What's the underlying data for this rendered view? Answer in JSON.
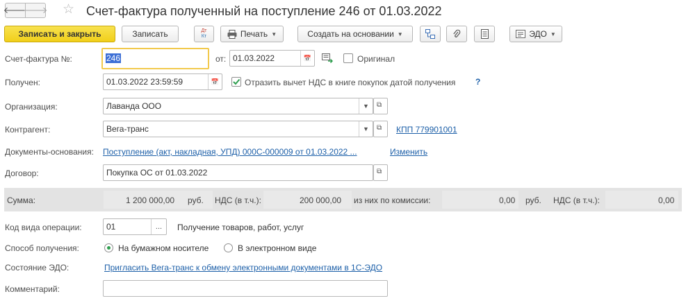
{
  "header": {
    "title": "Счет-фактура полученный на поступление 246 от 01.03.2022"
  },
  "toolbar": {
    "post_close": "Записать и закрыть",
    "save": "Записать",
    "dt_kt_top": "Дт",
    "dt_kt_bottom": "Кт",
    "print": "Печать",
    "create_based": "Создать на основании",
    "edo": "ЭДО"
  },
  "form": {
    "invoice_no_label": "Счет-фактура №:",
    "invoice_no": "246",
    "from_label": "от:",
    "invoice_date": "01.03.2022",
    "original_label": "Оригинал",
    "original_checked": false,
    "received_label": "Получен:",
    "received_datetime": "01.03.2022 23:59:59",
    "vat_deduction_label": "Отразить вычет НДС в книге покупок датой получения",
    "vat_deduction_checked": true,
    "help": "?",
    "org_label": "Организация:",
    "org": "Лаванда ООО",
    "counterparty_label": "Контрагент:",
    "counterparty": "Вега-транс",
    "kpp_link": "КПП 779901001",
    "base_docs_label": "Документы-основания:",
    "base_doc_link": "Поступление (акт, накладная, УПД) 000С-000009 от 01.03.2022 ...",
    "change_link": "Изменить",
    "contract_label": "Договор:",
    "contract": "Покупка ОС от 01.03.2022",
    "op_code_label": "Код вида операции:",
    "op_code": "01",
    "op_code_desc": "Получение товаров, работ, услуг",
    "receipt_method_label": "Способ получения:",
    "receipt_options": [
      "На бумажном носителе",
      "В электронном виде"
    ],
    "receipt_selected": "На бумажном носителе",
    "edo_state_label": "Состояние ЭДО:",
    "edo_invite_link": "Пригласить Вега-транс к обмену электронными документами в 1С-ЭДО",
    "comment_label": "Комментарий:",
    "comment": ""
  },
  "totals": {
    "sum_label": "Сумма:",
    "sum": "1 200 000,00",
    "currency1": "руб.",
    "vat_label1": "НДС (в т.ч.):",
    "vat1": "200 000,00",
    "commission_label": "из них по комиссии:",
    "commission": "0,00",
    "currency2": "руб.",
    "vat_label2": "НДС (в т.ч.):",
    "vat2": "0,00"
  },
  "colors": {
    "accent_yellow": "#f1cf1a",
    "link": "#1c5fa8",
    "focus": "#f2c94c",
    "selection": "#3d6fd6"
  }
}
